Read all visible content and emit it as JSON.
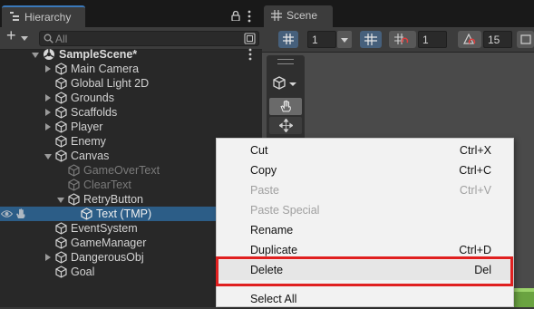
{
  "hierarchy": {
    "tab_label": "Hierarchy",
    "search_placeholder": "All",
    "rows": [
      {
        "label": "SampleScene*"
      },
      {
        "label": "Main Camera"
      },
      {
        "label": "Global Light 2D"
      },
      {
        "label": "Grounds"
      },
      {
        "label": "Scaffolds"
      },
      {
        "label": "Player"
      },
      {
        "label": "Enemy"
      },
      {
        "label": "Canvas"
      },
      {
        "label": "GameOverText"
      },
      {
        "label": "ClearText"
      },
      {
        "label": "RetryButton"
      },
      {
        "label": "Text (TMP)"
      },
      {
        "label": "EventSystem"
      },
      {
        "label": "GameManager"
      },
      {
        "label": "DangerousObj"
      },
      {
        "label": "Goal"
      }
    ],
    "selected_color": "#2c5d87"
  },
  "scene": {
    "tab_label": "Scene",
    "grid_value": "1",
    "snap_value": "1",
    "angle_value": "15"
  },
  "context_menu": {
    "items": [
      {
        "label": "Cut",
        "shortcut": "Ctrl+X"
      },
      {
        "label": "Copy",
        "shortcut": "Ctrl+C"
      },
      {
        "label": "Paste",
        "shortcut": "Ctrl+V"
      },
      {
        "label": "Paste Special",
        "shortcut": ""
      },
      {
        "label": "Rename",
        "shortcut": ""
      },
      {
        "label": "Duplicate",
        "shortcut": "Ctrl+D"
      },
      {
        "label": "Delete",
        "shortcut": "Del"
      },
      {
        "label": "Select All",
        "shortcut": ""
      }
    ],
    "highlight_color": "#e02020"
  }
}
